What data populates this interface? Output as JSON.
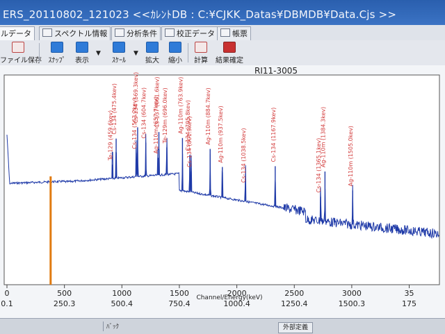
{
  "window": {
    "title": "ERS_20110802_121023 <<ｶﾚﾝﾄDB : C:¥CJKK_Datas¥DBMDB¥Data.Cjs >>"
  },
  "tabs": [
    {
      "label": "ルデータ",
      "active": true
    },
    {
      "label": "スペクトル情報",
      "active": false
    },
    {
      "label": "分析条件",
      "active": false
    },
    {
      "label": "校正データ",
      "active": false
    },
    {
      "label": "帳票",
      "active": false
    }
  ],
  "toolbar": {
    "file_save": "ファイル保存",
    "snap": "ｽﾅｯﾌﾟ",
    "display": "表示",
    "scale": "ｽｹｰﾙ",
    "zoom_in": "拡大",
    "zoom_out": "縮小",
    "calc": "計算",
    "result_confirm": "結果確定"
  },
  "status": {
    "cell": "ﾊﾞｯｸ",
    "button": "外部定義"
  },
  "chart_data": {
    "type": "line",
    "title": "RI11-3005",
    "xlabel": "Channel/Energy(keV)",
    "x_ticks": [
      {
        "channel": "0",
        "energy": "0.1"
      },
      {
        "channel": "500",
        "energy": "250.3"
      },
      {
        "channel": "1000",
        "energy": "500.4"
      },
      {
        "channel": "1500",
        "energy": "750.4"
      },
      {
        "channel": "2000",
        "energy": "1000.4"
      },
      {
        "channel": "2500",
        "energy": "1250.4"
      },
      {
        "channel": "3000",
        "energy": "1500.3"
      },
      {
        "channel": "35",
        "energy": "175"
      }
    ],
    "marker_channel": 380,
    "peaks": [
      {
        "label": "Te-129 (459.6kev)",
        "channel": 918
      },
      {
        "label": "Cs-134 (475.4kev)",
        "channel": 950
      },
      {
        "label": "Cs-134 (563.2kev)",
        "channel": 1125
      },
      {
        "label": "Cs-134 (569.3kev)",
        "channel": 1137
      },
      {
        "label": "Cs-134 (604.7kev)",
        "channel": 1208
      },
      {
        "label": "Ag-110m (657.7kev)",
        "channel": 1314
      },
      {
        "label": "Cs-137 (661.6kev)",
        "channel": 1322
      },
      {
        "label": "Te-129m (696.0kev)",
        "channel": 1391
      },
      {
        "label": "Ag-110m (763.9kev)",
        "channel": 1527
      },
      {
        "label": "Cs-134 (795.8kev)",
        "channel": 1591
      },
      {
        "label": "Cs-134 (801.9kev)",
        "channel": 1603
      },
      {
        "label": "Ag-110m (884.7kev)",
        "channel": 1768
      },
      {
        "label": "Ag-110m (937.5kev)",
        "channel": 1874
      },
      {
        "label": "Cs-134 (1038.5kev)",
        "channel": 2075
      },
      {
        "label": "Cs-134 (1167.9kev)",
        "channel": 2334
      },
      {
        "label": "Cs-134 (1365.1kev)",
        "channel": 2729
      },
      {
        "label": "Ag-110m (1384.3kev)",
        "channel": 2767
      },
      {
        "label": "Ag-110m (1505.0kev)",
        "channel": 3008
      }
    ]
  }
}
